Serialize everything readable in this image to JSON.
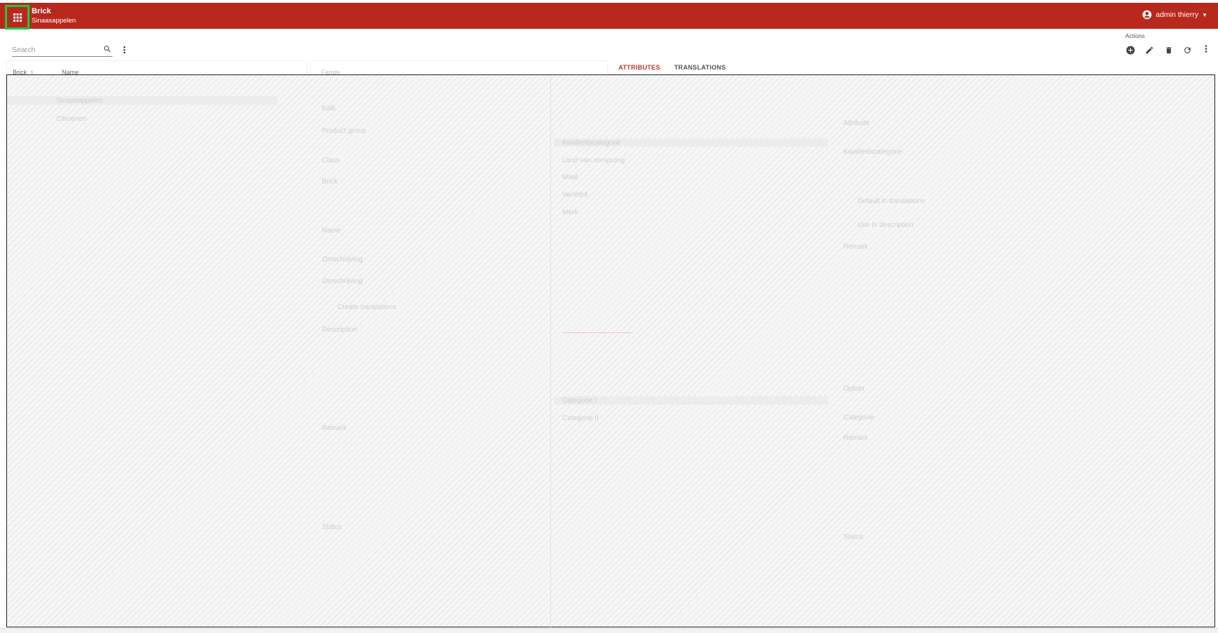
{
  "header": {
    "app_title": "Brick",
    "app_subtitle": "Sinaasappelen",
    "user_name": "admin thierry",
    "accent_color": "#b8281c"
  },
  "toolbar": {
    "search_placeholder": "Search",
    "actions_label": "Actions",
    "action_icons": [
      "add-circle-icon",
      "edit-icon",
      "delete-icon",
      "refresh-icon",
      "more-vert-icon"
    ]
  },
  "list": {
    "columns": [
      "Brick",
      "Name"
    ]
  },
  "detail": {
    "field_label": "Family"
  },
  "tabs": [
    {
      "label": "ATTRIBUTES",
      "active": true
    },
    {
      "label": "TRANSLATIONS",
      "active": false
    }
  ],
  "ghost_labels": {
    "left_col": [
      "Kalk",
      "Product group",
      "Class",
      "Brick",
      "Name",
      "Omschrijving",
      "Omschrijving",
      "Create translations",
      "Description",
      "Remark",
      "Status"
    ],
    "right_col": [
      "Attribute",
      "Kwaliteitscategorie",
      "Default in translations",
      "Use in description",
      "Remark",
      "Option",
      "Categorie",
      "Remark",
      "Status"
    ],
    "table_rows": [
      "Kwaliteitscategorie",
      "Land van oorsprong",
      "Maat",
      "Variëteit",
      "Merk"
    ],
    "option_rows": [
      "Categorie I",
      "Categorie II"
    ],
    "list_rows": [
      "Sinaasappelen",
      "Citroenen"
    ]
  }
}
